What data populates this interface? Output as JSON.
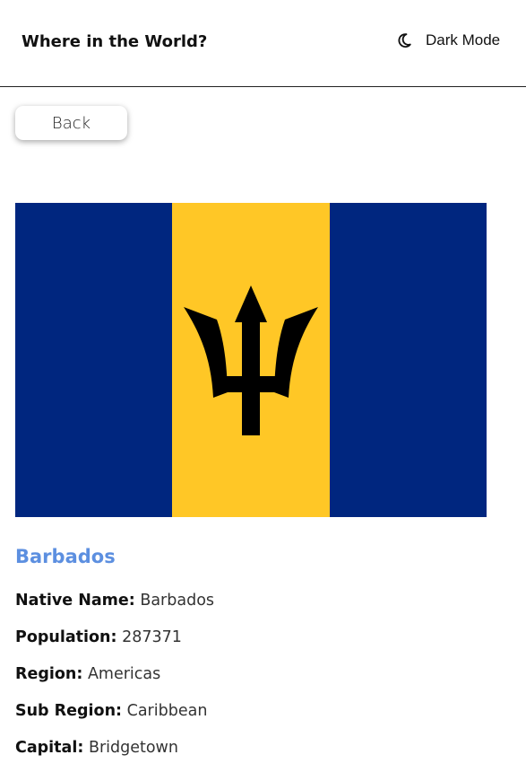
{
  "header": {
    "title": "Where in the World?",
    "mode_label": "Dark Mode",
    "mode_icon": "moon-icon"
  },
  "nav": {
    "back_label": "Back"
  },
  "flag": {
    "country": "Barbados",
    "colors": {
      "blue": "#00267F",
      "gold": "#FFC726",
      "trident": "#000000"
    }
  },
  "country": {
    "name": "Barbados",
    "details": [
      {
        "label": "Native Name:",
        "value": "Barbados"
      },
      {
        "label": "Population:",
        "value": "287371"
      },
      {
        "label": "Region:",
        "value": "Americas"
      },
      {
        "label": "Sub Region:",
        "value": "Caribbean"
      },
      {
        "label": "Capital:",
        "value": "Bridgetown"
      }
    ]
  },
  "theme": {
    "accent": "#5c8fe0"
  }
}
